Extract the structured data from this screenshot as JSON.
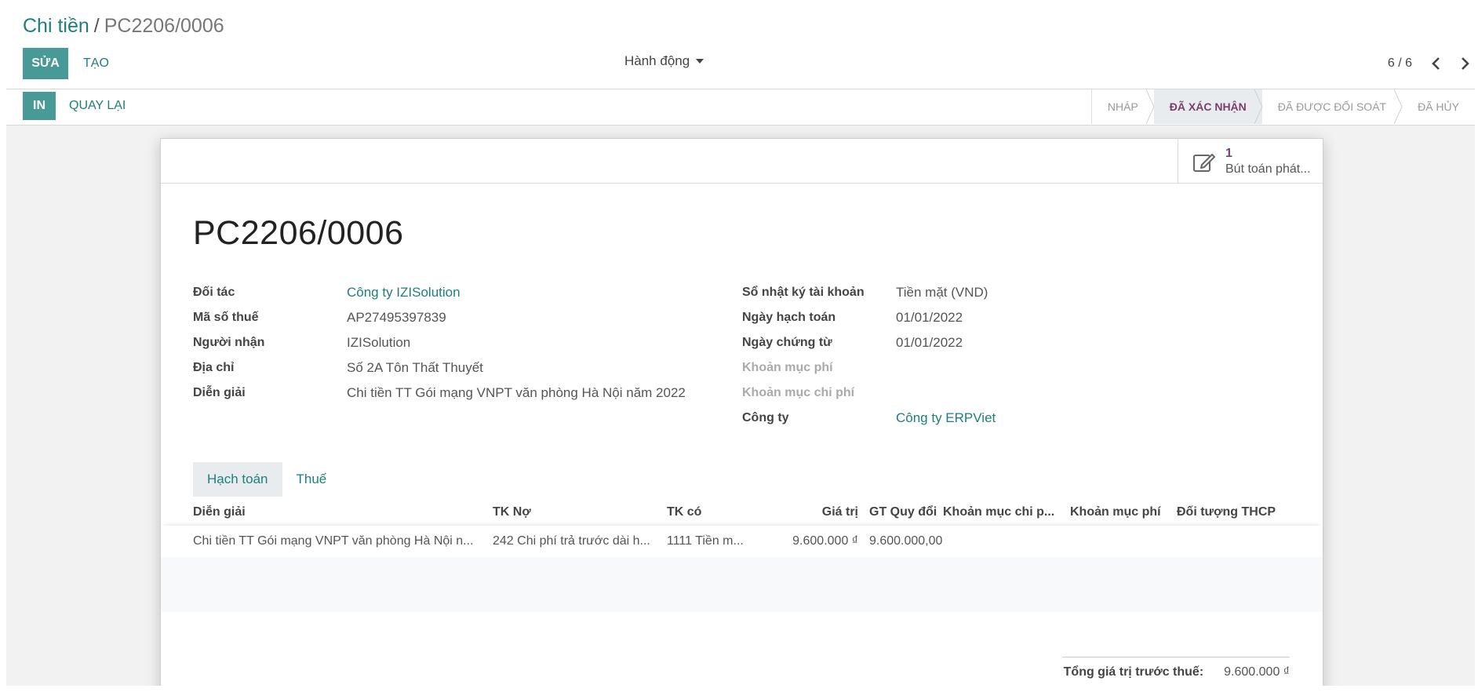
{
  "breadcrumb": {
    "parent": "Chi tiền",
    "separator": "/",
    "current": "PC2206/0006"
  },
  "toolbar": {
    "edit_label": "SỬA",
    "create_label": "TẠO",
    "actions_label": "Hành động",
    "print_label": "IN",
    "back_label": "QUAY LẠI"
  },
  "pager": {
    "value": "6 / 6"
  },
  "statusbar": {
    "stages": [
      {
        "label": "NHÁP",
        "active": false
      },
      {
        "label": "ĐÃ XÁC NHẬN",
        "active": true
      },
      {
        "label": "ĐÃ ĐƯỢC ĐỐI SOÁT",
        "active": false
      },
      {
        "label": "ĐÃ HỦY",
        "active": false
      }
    ]
  },
  "smart_button": {
    "value": "1",
    "text": "Bút toán phát..."
  },
  "record": {
    "title": "PC2206/0006"
  },
  "fields_left": [
    {
      "label": "Đối tác",
      "value": "Công ty IZISolution",
      "link": true
    },
    {
      "label": "Mã số thuế",
      "value": "AP27495397839",
      "link": false
    },
    {
      "label": "Người nhận",
      "value": "IZISolution",
      "link": false
    },
    {
      "label": "Địa chỉ",
      "value": "Số 2A Tôn Thất Thuyết",
      "link": false
    },
    {
      "label": "Diễn giải",
      "value": "Chi tiền TT Gói mạng VNPT văn phòng Hà Nội năm 2022",
      "link": false
    }
  ],
  "fields_right": [
    {
      "label": "Sổ nhật ký tài khoản",
      "value": "Tiền mặt (VND)",
      "link": false,
      "muted": false
    },
    {
      "label": "Ngày hạch toán",
      "value": "01/01/2022",
      "link": false,
      "muted": false
    },
    {
      "label": "Ngày chứng từ",
      "value": "01/01/2022",
      "link": false,
      "muted": false
    },
    {
      "label": "Khoản mục phí",
      "value": "",
      "link": false,
      "muted": true
    },
    {
      "label": "Khoản mục chi phí",
      "value": "",
      "link": false,
      "muted": true
    },
    {
      "label": "Công ty",
      "value": "Công ty ERPViet",
      "link": true,
      "muted": false
    }
  ],
  "tabs": [
    {
      "label": "Hạch toán",
      "active": true
    },
    {
      "label": "Thuế",
      "active": false
    }
  ],
  "table": {
    "headers": [
      "Diễn giải",
      "TK Nợ",
      "TK có",
      "Giá trị",
      "GT Quy đổi",
      "Khoản mục chi p...",
      "Khoản mục phí",
      "Đối tượng THCP"
    ],
    "rows": [
      [
        "Chi tiền TT Gói mạng VNPT văn phòng Hà Nội n...",
        "242 Chi phí trả trước dài h...",
        "1111 Tiền m...",
        "9.600.000 ₫",
        "9.600.000,00",
        "",
        "",
        ""
      ]
    ]
  },
  "totals": {
    "label": "Tổng giá trị trước thuế:",
    "value": "9.600.000 ₫"
  },
  "colors": {
    "primary": "#479a95",
    "link": "#1e7f7a",
    "active_stage": "#7a3f68"
  }
}
